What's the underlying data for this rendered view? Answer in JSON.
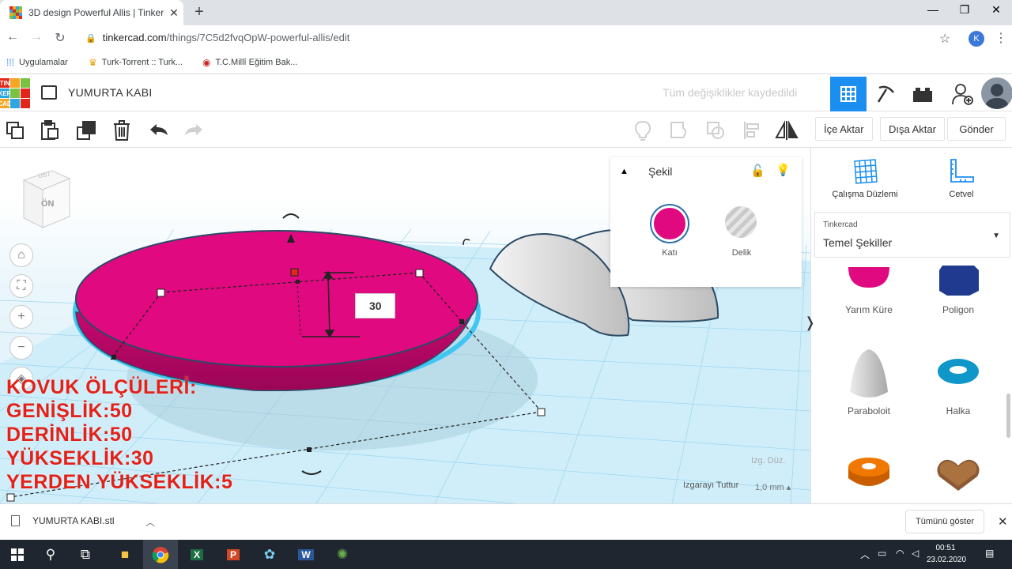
{
  "browser": {
    "tab_title": "3D design Powerful Allis | Tinkercad",
    "tab_close": "✕",
    "new_tab": "+",
    "url_host": "tinkercad.com",
    "url_path": "/things/7C5d2fvqOpW-powerful-allis/edit",
    "avatar_letter": "K",
    "bookmarks": [
      "Uygulamalar",
      "Turk-Torrent :: Turk...",
      "T.C.Millî Eğitim Bak..."
    ]
  },
  "header": {
    "logo_letters": [
      "TIN",
      "KER",
      "CAD"
    ],
    "project_name": "YUMURTA KABI",
    "save_status": "Tüm değişiklikler kaydedildi"
  },
  "toolbar": {
    "import": "İçe Aktar",
    "export": "Dışa Aktar",
    "send": "Gönder"
  },
  "inspector": {
    "title": "Şekil",
    "solid_label": "Katı",
    "hole_label": "Delik",
    "solid_color": "#e0097f"
  },
  "right_panel": {
    "workplane": "Çalışma Düzlemi",
    "ruler": "Cetvel",
    "library_source": "Tinkercad",
    "library_name": "Temel Şekiller",
    "shapes": [
      "Yarım Küre",
      "Poligon",
      "Paraboloit",
      "Halka"
    ]
  },
  "viewport": {
    "cube_front": "ÖN",
    "cube_top": "ÜST",
    "dimension_value": "30",
    "grid_edit": "Izg. Düz.",
    "snap_label": "Izgarayı Tuttur",
    "snap_value": "1,0 mm",
    "overlay_lines": [
      "KOVUK ÖLÇÜLERİ:",
      "GENİŞLİK:50",
      "DERİNLİK:50",
      "YÜKSEKLİK:30",
      "YERDEN YÜKSEKLİK:5"
    ]
  },
  "downloads": {
    "file": "YUMURTA KABI.stl",
    "show_all": "Tümünü göster"
  },
  "taskbar": {
    "time": "00:51",
    "date": "23.02.2020"
  },
  "colors": {
    "accent": "#1b8ef2",
    "shape_pink": "#e0097f",
    "overlay_red": "#e32118"
  }
}
